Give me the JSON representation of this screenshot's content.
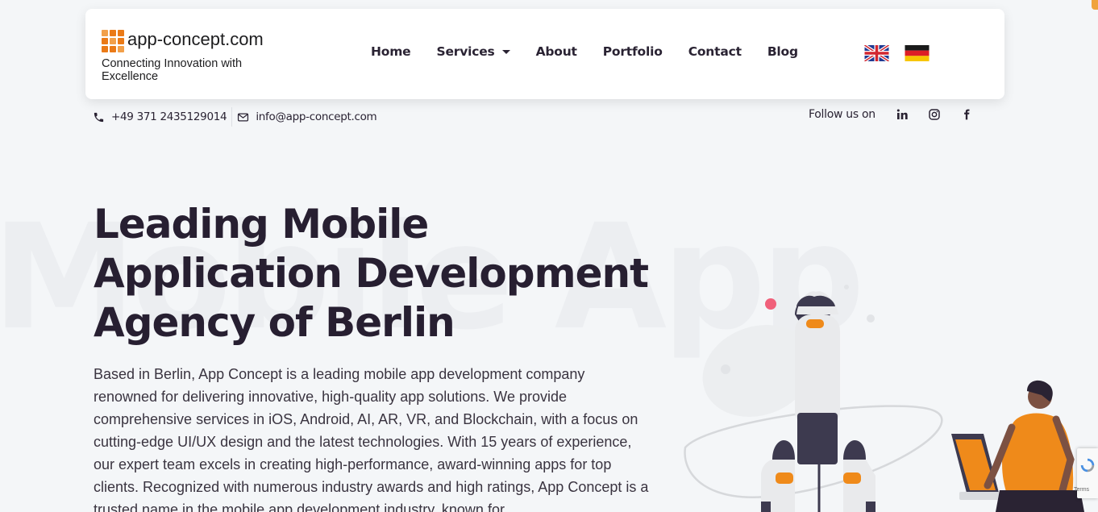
{
  "background_word": "Mobile App",
  "header": {
    "logo_name": "app-concept.com",
    "logo_tagline": "Connecting Innovation with Excellence",
    "nav": [
      {
        "label": "Home"
      },
      {
        "label": "Services",
        "has_dropdown": true
      },
      {
        "label": "About"
      },
      {
        "label": "Portfolio"
      },
      {
        "label": "Contact"
      },
      {
        "label": "Blog"
      }
    ],
    "languages": [
      {
        "icon": "uk-flag-icon",
        "lang": "English"
      },
      {
        "icon": "germany-flag-icon",
        "lang": "German"
      }
    ]
  },
  "contact": {
    "phone": "+49 371 2435129014",
    "email": "info@app-concept.com",
    "phone_icon": "phone-icon",
    "email_icon": "mail-icon"
  },
  "social": {
    "label": "Follow us on",
    "icons": [
      "linkedin-icon",
      "instagram-icon",
      "facebook-icon"
    ]
  },
  "hero": {
    "title": "Leading Mobile Application Development Agency of Berlin",
    "text": "Based in Berlin, App Concept is a leading mobile app development company renowned for delivering innovative, high-quality app solutions. We provide comprehensive services in iOS, Android, AI, AR, VR, and Blockchain, with a focus on cutting-edge UI/UX design and the latest technologies. With 15 years of experience, our expert team excels in creating high-performance, award-winning apps for top clients. Recognized with numerous industry awards and high ratings, App Concept is a trusted name in the mobile app development industry, known for"
  },
  "colors": {
    "brand_orange": "#ea7a17",
    "text_dark": "#271f31",
    "background": "#f4f6f8",
    "accent_pink": "#f0607a"
  },
  "recaptcha_text": "Terms"
}
